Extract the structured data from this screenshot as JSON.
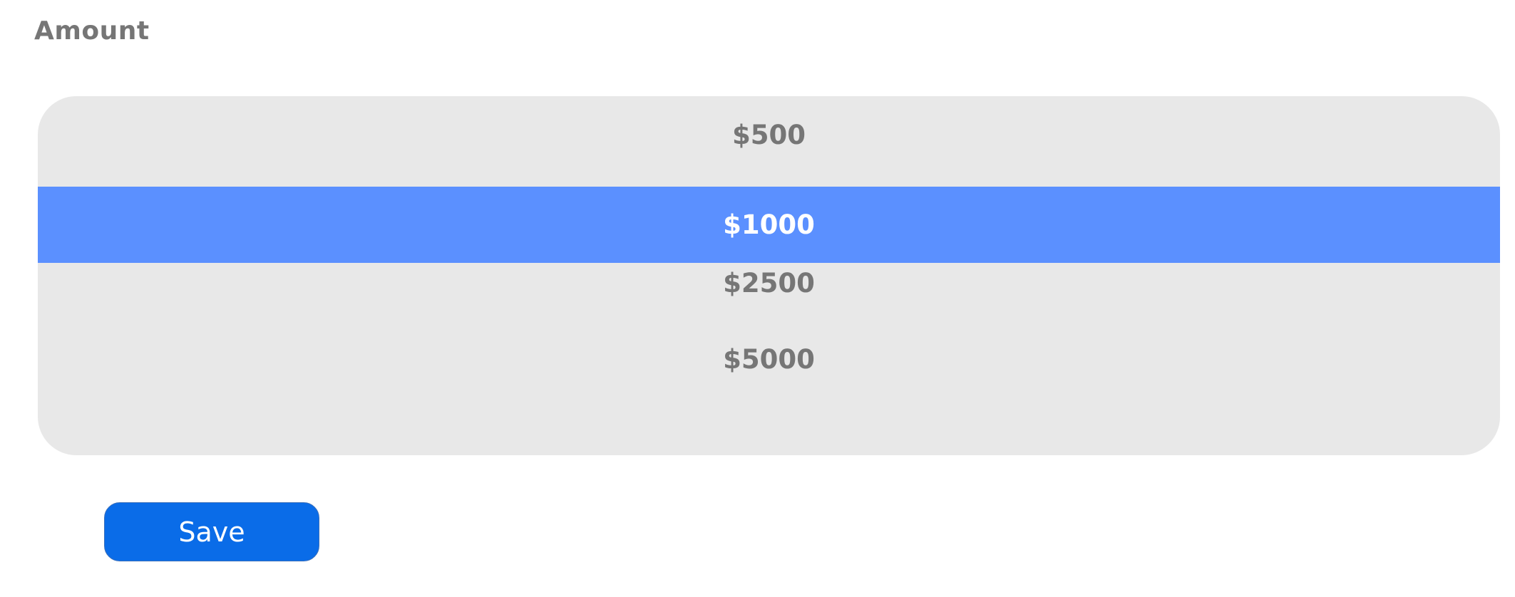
{
  "field": {
    "label": "Amount"
  },
  "listbox": {
    "options": [
      {
        "label": "$500",
        "selected": false
      },
      {
        "label": "$1000",
        "selected": true
      },
      {
        "label": "$2500",
        "selected": false
      },
      {
        "label": "$5000",
        "selected": false
      }
    ]
  },
  "actions": {
    "save_label": "Save"
  },
  "colors": {
    "selected_background": "#5b90ff",
    "listbox_background": "#e8e8e8",
    "button_background": "#0a6ce8",
    "text_muted": "#767676"
  }
}
